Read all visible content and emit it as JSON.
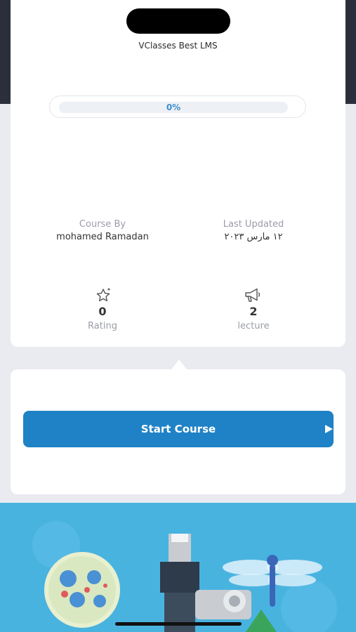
{
  "app": {
    "title": "VClasses Best LMS"
  },
  "progress": {
    "text": "0%",
    "value": 0
  },
  "course_info": {
    "by_label": "Course By",
    "by_value": "mohamed Ramadan",
    "updated_label": "Last Updated",
    "updated_value": "١٢ مارس ٢٠٢٣"
  },
  "stats": {
    "rating": {
      "value": "0",
      "label": "Rating",
      "icon": "star-sparkle-icon"
    },
    "lectures": {
      "value": "2",
      "label": "lecture",
      "icon": "megaphone-icon"
    }
  },
  "actions": {
    "start_label": "Start Course",
    "start_icon": "play-icon"
  },
  "colors": {
    "accent": "#1f82c6",
    "header_dark": "#2a2f3b",
    "banner_sky": "#49b3e0"
  }
}
